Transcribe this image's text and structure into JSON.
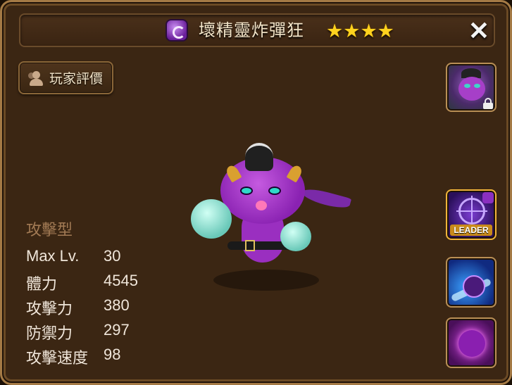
{
  "header": {
    "title": "壞精靈炸彈狂",
    "attribute": "dark",
    "attribute_icon": "dark-attribute-icon",
    "stars": [
      "★",
      "★",
      "★",
      "★"
    ],
    "star_count": 4,
    "close_label": "✕"
  },
  "review_button": {
    "label": "玩家評價",
    "icon": "user-icon"
  },
  "portrait": {
    "icon": "monster-portrait-icon",
    "locked": true
  },
  "skills": {
    "leader_label": "LEADER",
    "items": [
      {
        "icon": "leader-skill-icon"
      },
      {
        "icon": "bomb-skill-icon"
      },
      {
        "icon": "dark-face-skill-icon"
      }
    ]
  },
  "stats": {
    "type": "攻擊型",
    "rows": [
      {
        "label": "Max Lv.",
        "value": "30"
      },
      {
        "label": "體力",
        "value": "4545"
      },
      {
        "label": "攻擊力",
        "value": "380"
      },
      {
        "label": "防禦力",
        "value": "297"
      },
      {
        "label": "攻擊速度",
        "value": "98"
      }
    ]
  },
  "colors": {
    "panel_bg": "#3b2613",
    "frame_border": "#a47a45",
    "title_text": "#f2e4c8",
    "star": "#ffd21e",
    "stat_type": "#a27a54",
    "stat_text": "#f0e6da",
    "dark_attribute": "#8a2fc0"
  }
}
